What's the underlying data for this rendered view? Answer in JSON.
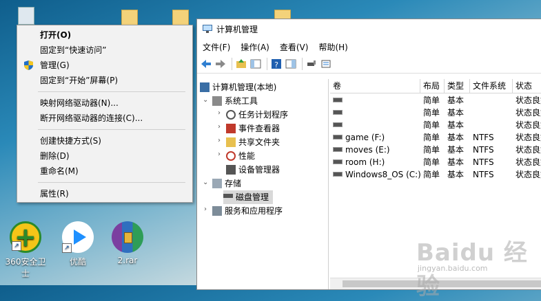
{
  "desktop": {
    "icons": [
      {
        "label": "360安全卫士"
      },
      {
        "label": "优酷"
      },
      {
        "label": "2.rar"
      }
    ]
  },
  "context_menu": {
    "items": [
      {
        "label": "打开(O)",
        "bold": true
      },
      {
        "label": "固定到“快速访问”"
      },
      {
        "label": "管理(G)",
        "icon": "shield-icon"
      },
      {
        "label": "固定到“开始”屏幕(P)"
      },
      {
        "label": "映射网络驱动器(N)..."
      },
      {
        "label": "断开网络驱动器的连接(C)..."
      },
      {
        "label": "创建快捷方式(S)"
      },
      {
        "label": "删除(D)"
      },
      {
        "label": "重命名(M)"
      },
      {
        "label": "属性(R)"
      }
    ]
  },
  "window": {
    "title": "计算机管理",
    "menu": [
      "文件(F)",
      "操作(A)",
      "查看(V)",
      "帮助(H)"
    ],
    "tree": [
      {
        "label": "计算机管理(本地)"
      },
      {
        "label": "系统工具"
      },
      {
        "label": "任务计划程序"
      },
      {
        "label": "事件查看器"
      },
      {
        "label": "共享文件夹"
      },
      {
        "label": "性能"
      },
      {
        "label": "设备管理器"
      },
      {
        "label": "存储"
      },
      {
        "label": "磁盘管理"
      },
      {
        "label": "服务和应用程序"
      }
    ],
    "columns": [
      "卷",
      "布局",
      "类型",
      "文件系统",
      "状态"
    ],
    "volumes": [
      {
        "name": "",
        "layout": "简单",
        "type": "基本",
        "fs": "",
        "status": "状态良好"
      },
      {
        "name": "",
        "layout": "简单",
        "type": "基本",
        "fs": "",
        "status": "状态良好"
      },
      {
        "name": "",
        "layout": "简单",
        "type": "基本",
        "fs": "",
        "status": "状态良好"
      },
      {
        "name": "game (F:)",
        "layout": "简单",
        "type": "基本",
        "fs": "NTFS",
        "status": "状态良好"
      },
      {
        "name": "moves (E:)",
        "layout": "简单",
        "type": "基本",
        "fs": "NTFS",
        "status": "状态良好"
      },
      {
        "name": "room (H:)",
        "layout": "简单",
        "type": "基本",
        "fs": "NTFS",
        "status": "状态良好"
      },
      {
        "name": "Windows8_OS (C:)",
        "layout": "简单",
        "type": "基本",
        "fs": "NTFS",
        "status": "状态良好"
      }
    ]
  },
  "watermark": {
    "text": "Baidu 经验",
    "sub": "jingyan.baidu.com"
  },
  "colors": {
    "accent": "#0a64ad",
    "selection": "#cce8ff",
    "menu_bg": "#f2f2f2"
  }
}
